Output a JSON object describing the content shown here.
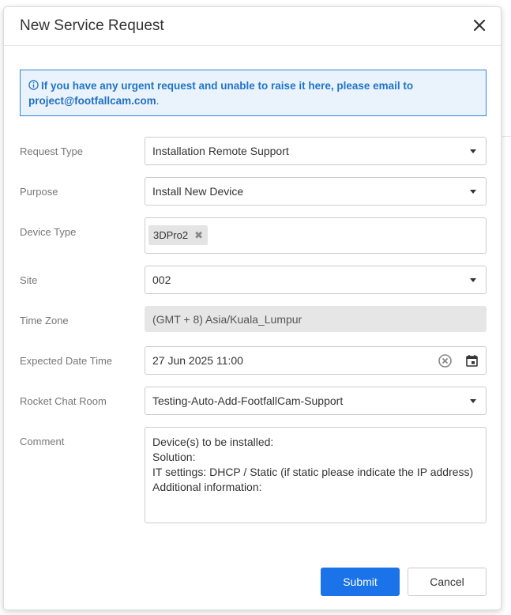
{
  "modal": {
    "title": "New Service Request"
  },
  "alert": {
    "message": "If you have any urgent request and unable to raise it here, please email to",
    "email": "project@footfallcam.com",
    "suffix": "."
  },
  "form": {
    "request_type": {
      "label": "Request Type",
      "value": "Installation Remote Support"
    },
    "purpose": {
      "label": "Purpose",
      "value": "Install New Device"
    },
    "device_type": {
      "label": "Device Type",
      "tags": [
        "3DPro2"
      ],
      "remove_glyph": "✖"
    },
    "site": {
      "label": "Site",
      "value": "002"
    },
    "time_zone": {
      "label": "Time Zone",
      "value": "(GMT + 8) Asia/Kuala_Lumpur"
    },
    "expected_datetime": {
      "label": "Expected Date Time",
      "value": "27 Jun 2025 11:00"
    },
    "rocket_chat_room": {
      "label": "Rocket Chat Room",
      "value": "Testing-Auto-Add-FootfallCam-Support"
    },
    "comment": {
      "label": "Comment",
      "lines": [
        "Device(s) to be installed:",
        "Solution:",
        "IT settings: DHCP / Static (if static please indicate the IP address)",
        "Additional information:"
      ]
    }
  },
  "buttons": {
    "submit": "Submit",
    "cancel": "Cancel"
  },
  "colors": {
    "primary": "#1a73e8",
    "alert_border": "#2f86d6",
    "alert_background": "#eaf3fb",
    "disabled_field": "#e6e6e6"
  },
  "icons": {
    "close": "close-icon",
    "info": "info-icon",
    "dropdown": "chevron-down-icon",
    "clear": "clear-icon",
    "calendar": "calendar-icon"
  }
}
